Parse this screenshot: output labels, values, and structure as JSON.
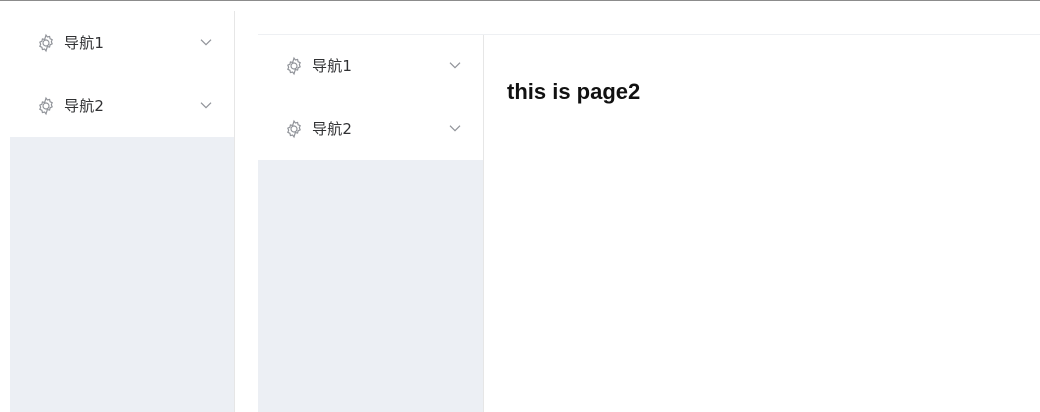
{
  "outer_sidebar": {
    "items": [
      {
        "label": "导航1",
        "icon": "gear-icon",
        "expand_icon": "chevron-down-icon"
      },
      {
        "label": "导航2",
        "icon": "gear-icon",
        "expand_icon": "chevron-down-icon"
      }
    ]
  },
  "inner_sidebar": {
    "items": [
      {
        "label": "导航1",
        "icon": "gear-icon",
        "expand_icon": "chevron-down-icon"
      },
      {
        "label": "导航2",
        "icon": "gear-icon",
        "expand_icon": "chevron-down-icon"
      }
    ]
  },
  "main": {
    "heading": "this is page2"
  },
  "colors": {
    "sidebar_bg": "#eceff4",
    "menu_bg": "#ffffff",
    "text": "#303133",
    "icon": "#909399"
  }
}
